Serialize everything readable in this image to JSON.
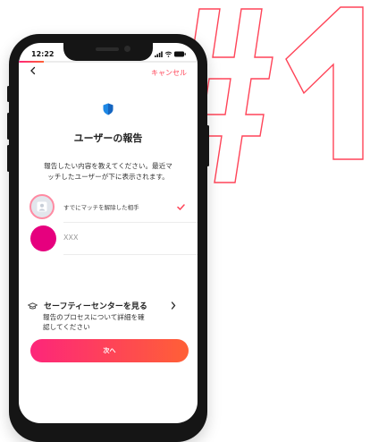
{
  "colors": {
    "accent": "#ff4458",
    "gradient_start": "#fd267a",
    "gradient_end": "#ff6036",
    "avatar_pink": "#e6007e",
    "shield_blue": "#1e88e5"
  },
  "decor": {
    "hash_text": "#1"
  },
  "status_bar": {
    "time": "12:22",
    "icons": [
      "signal-icon",
      "wifi-icon",
      "battery-icon"
    ]
  },
  "progress": {
    "fraction": 0.14
  },
  "header": {
    "back_icon": "chevron-left-icon",
    "cancel_label": "キャンセル"
  },
  "report": {
    "shield_icon": "shield-icon",
    "title": "ユーザーの報告",
    "description_line1": "報告したい内容を教えてください。最近マ",
    "description_line2": "ッチしたユーザーが下に表示されます。",
    "options": [
      {
        "label": "すでにマッチを解除した相手",
        "selected": true
      },
      {
        "label": "XXX",
        "selected": false
      }
    ]
  },
  "safety": {
    "icon": "graduation-cap-icon",
    "title": "セーフティーセンターを見る",
    "arrow_icon": "chevron-right-icon",
    "description_line1": "報告のプロセスについて詳細を確",
    "description_line2": "認してください"
  },
  "actions": {
    "next_label": "次へ"
  }
}
